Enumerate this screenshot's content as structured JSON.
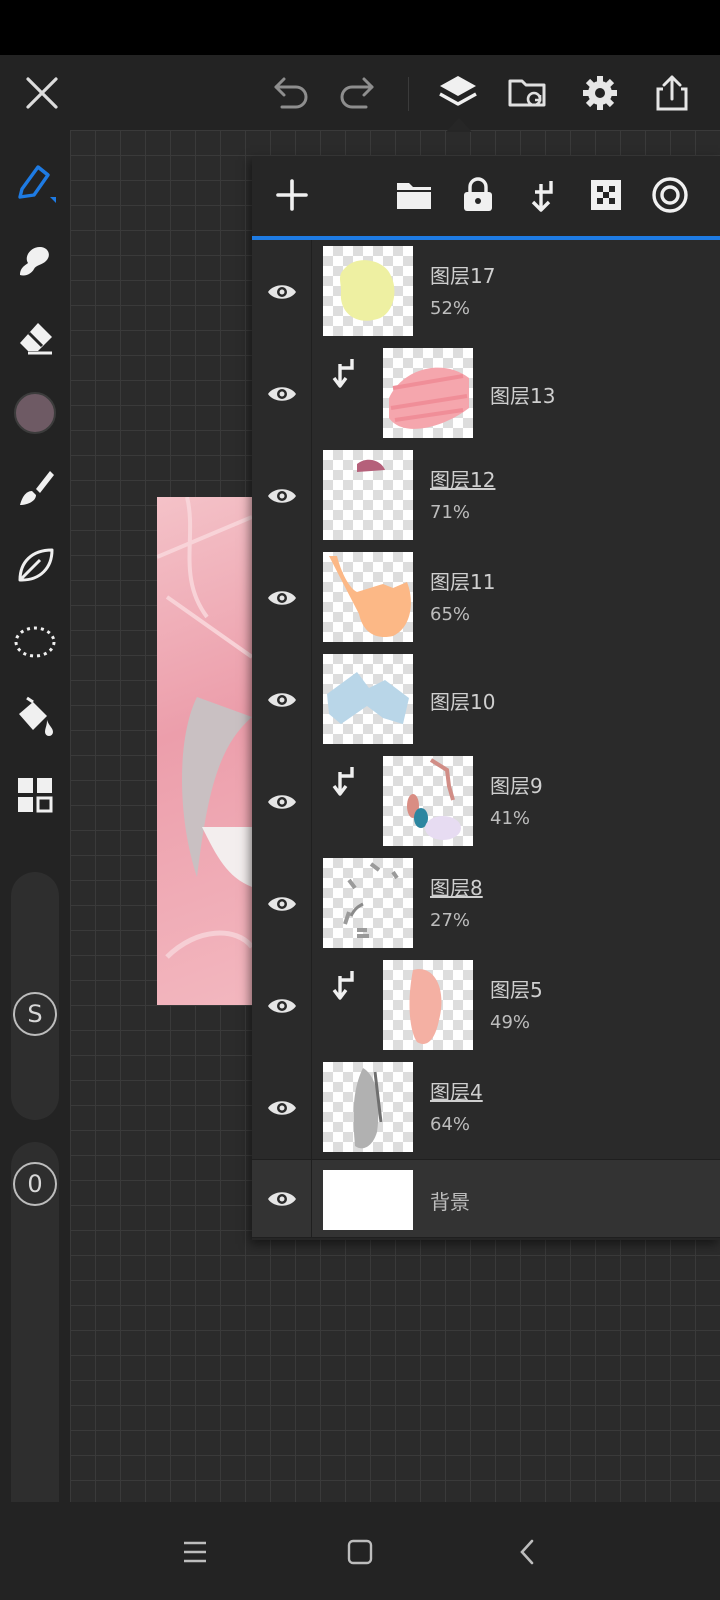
{
  "app": {
    "accent_color": "#1e7be3",
    "current_color": "#6e5a64"
  },
  "top_bar": {
    "icons": [
      "close-icon",
      "undo-icon",
      "redo-icon",
      "layers-icon",
      "folder-sync-icon",
      "gear-icon",
      "share-icon"
    ]
  },
  "sidebar": {
    "tools": [
      "pen-icon",
      "smudge-icon",
      "eraser-icon",
      "color-swatch",
      "brush-icon",
      "leaf-icon",
      "lasso-icon",
      "fill-icon",
      "grid-icon"
    ],
    "size_label": "S",
    "opacity_label": "0"
  },
  "layer_panel": {
    "toolbar_icons": [
      "add-icon",
      "folder-icon",
      "lock-icon",
      "clip-icon",
      "transparency-icon",
      "target-icon"
    ],
    "layers": [
      {
        "name": "图层17",
        "opacity": "52%",
        "clipped": false,
        "underlined": false
      },
      {
        "name": "图层13",
        "opacity": "",
        "clipped": true,
        "underlined": false
      },
      {
        "name": "图层12",
        "opacity": "71%",
        "clipped": false,
        "underlined": true
      },
      {
        "name": "图层11",
        "opacity": "65%",
        "clipped": false,
        "underlined": false
      },
      {
        "name": "图层10",
        "opacity": "",
        "clipped": false,
        "underlined": false
      },
      {
        "name": "图层9",
        "opacity": "41%",
        "clipped": true,
        "underlined": false
      },
      {
        "name": "图层8",
        "opacity": "27%",
        "clipped": false,
        "underlined": true
      },
      {
        "name": "图层5",
        "opacity": "49%",
        "clipped": true,
        "underlined": false
      },
      {
        "name": "图层4",
        "opacity": "64%",
        "clipped": false,
        "underlined": true
      }
    ],
    "background_layer": {
      "name": "背景"
    }
  },
  "nav_bar": {
    "icons": [
      "menu-icon",
      "home-icon",
      "back-icon"
    ]
  }
}
